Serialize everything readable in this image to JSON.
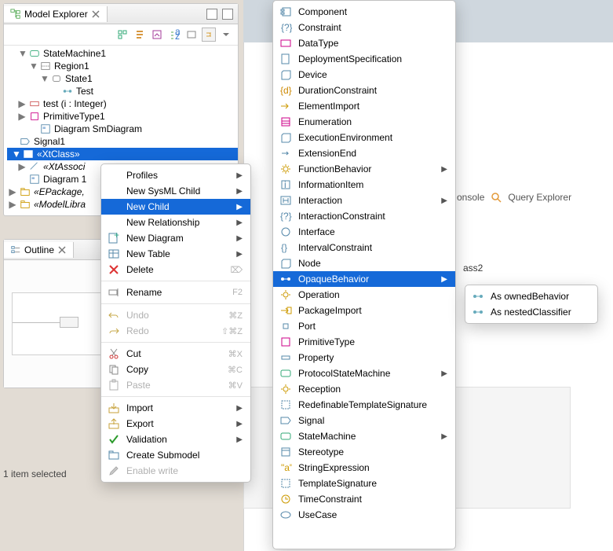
{
  "modelExplorer": {
    "title": "Model Explorer",
    "tree": {
      "stateMachine": "StateMachine1",
      "region": "Region1",
      "state": "State1",
      "test": "Test",
      "op": "test (i : Integer)",
      "primType": "PrimitiveType1",
      "diagSm": "Diagram SmDiagram",
      "signal": "Signal1",
      "xtClass": "«XtClass»",
      "xtAssoc": "«XtAssoci",
      "diag1": "Diagram 1",
      "ePackage": "«EPackage,",
      "modelLib": "«ModelLibra"
    }
  },
  "outline": {
    "title": "Outline"
  },
  "status": "1 item selected",
  "bgTabs": {
    "console": "onsole",
    "query": "Query Explorer"
  },
  "bgClass": "ass2",
  "contextMenu": {
    "profiles": "Profiles",
    "newSysml": "New SysML Child",
    "newChild": "New Child",
    "newRel": "New Relationship",
    "newDiagram": "New Diagram",
    "newTable": "New Table",
    "delete": "Delete",
    "deleteKey": "⌦",
    "rename": "Rename",
    "renameKey": "F2",
    "undo": "Undo",
    "undoKey": "⌘Z",
    "redo": "Redo",
    "redoKey": "⇧⌘Z",
    "cut": "Cut",
    "cutKey": "⌘X",
    "copy": "Copy",
    "copyKey": "⌘C",
    "paste": "Paste",
    "pasteKey": "⌘V",
    "import": "Import",
    "export": "Export",
    "validation": "Validation",
    "createSub": "Create Submodel",
    "enableWrite": "Enable write"
  },
  "childMenu": {
    "component": "Component",
    "constraint": "Constraint",
    "dataType": "DataType",
    "deploySpec": "DeploymentSpecification",
    "device": "Device",
    "durConstraint": "DurationConstraint",
    "elemImport": "ElementImport",
    "enumeration": "Enumeration",
    "execEnv": "ExecutionEnvironment",
    "extEnd": "ExtensionEnd",
    "funcBehavior": "FunctionBehavior",
    "infoItem": "InformationItem",
    "interaction": "Interaction",
    "interConstraint": "InteractionConstraint",
    "interface": "Interface",
    "intervalConstraint": "IntervalConstraint",
    "node": "Node",
    "opaqueBehavior": "OpaqueBehavior",
    "operation": "Operation",
    "packageImport": "PackageImport",
    "port": "Port",
    "primitiveType": "PrimitiveType",
    "property": "Property",
    "protoStateMachine": "ProtocolStateMachine",
    "reception": "Reception",
    "redefTemplate": "RedefinableTemplateSignature",
    "signal": "Signal",
    "stateMachine": "StateMachine",
    "stereotype": "Stereotype",
    "stringExpr": "StringExpression",
    "templateSig": "TemplateSignature",
    "timeConstraint": "TimeConstraint",
    "useCase": "UseCase"
  },
  "subMenu": {
    "ownedBehavior": "As ownedBehavior",
    "nestedClassifier": "As nestedClassifier"
  }
}
